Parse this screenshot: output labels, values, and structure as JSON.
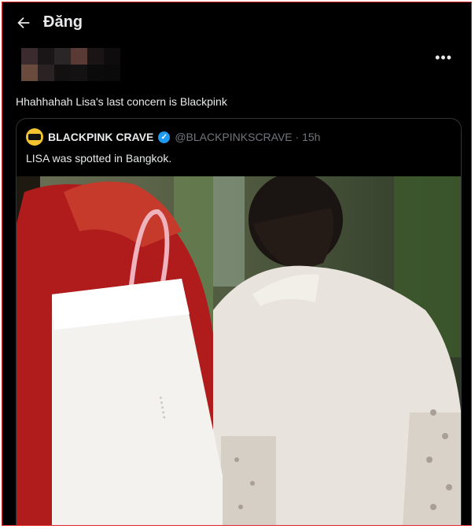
{
  "header": {
    "back_icon": "arrow-left-icon",
    "title": "Đăng"
  },
  "post": {
    "more_icon": "more-horizontal-icon",
    "text": "Hhahhahah Lisa's last concern is Blackpink"
  },
  "quote": {
    "logo_icon": "blackpink-crave-logo",
    "display_name": "BLACKPINK CRAVE",
    "verified_icon": "verified-badge-icon",
    "handle_time": "@BLACKPINKSCRAVE · 15h",
    "text": "LISA was spotted in Bangkok."
  },
  "colors": {
    "background": "#000000",
    "text": "#e7e9ea",
    "muted": "#71767b",
    "verified": "#1d9bf0",
    "frame": "#e0262b"
  }
}
